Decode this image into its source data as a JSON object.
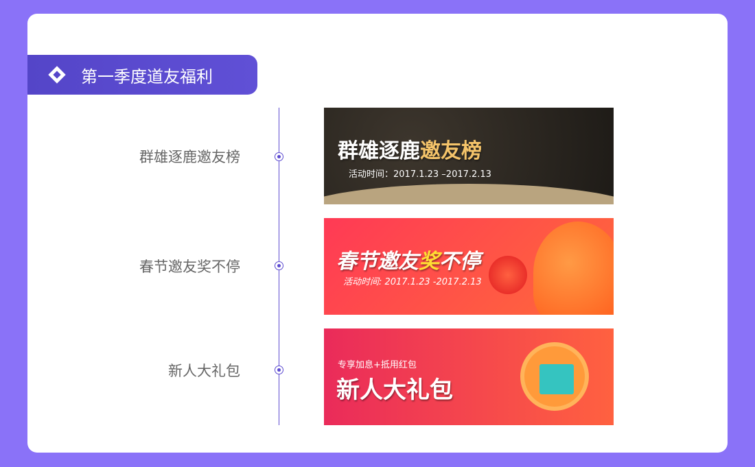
{
  "section_title": "第一季度道友福利",
  "items": [
    {
      "label": "群雄逐鹿邀友榜",
      "banner_title_a": "群雄逐鹿",
      "banner_title_b": "邀友榜",
      "banner_sub": "活动时间：2017.1.23 –2017.2.13"
    },
    {
      "label": "春节邀友奖不停",
      "banner_title_a": "春节邀友",
      "banner_title_b": "奖",
      "banner_title_c": "不停",
      "banner_sub": "活动时间:  2017.1.23 -2017.2.13"
    },
    {
      "label": "新人大礼包",
      "banner_sub": "专享加息+抵用红包",
      "banner_title_a": "新人大礼包"
    }
  ]
}
